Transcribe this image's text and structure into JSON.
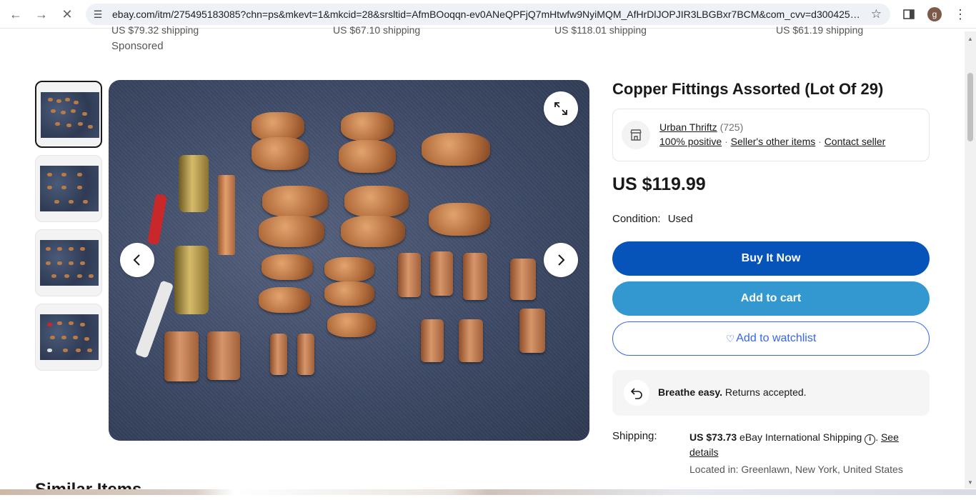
{
  "browser": {
    "url": "ebay.com/itm/275495183085?chn=ps&mkevt=1&mkcid=28&srsltid=AfmBOoqqn-ev0ANeQPFjQ7mHtwfw9NyiMQM_AfHrDlJOPJIR3LBGBxr7BCM&com_cvv=d30042528...",
    "avatar_letter": "g"
  },
  "sponsored_strip": {
    "items": [
      "US $79.32 shipping",
      "US $67.10 shipping",
      "US $118.01 shipping",
      "US $61.19 shipping"
    ],
    "sponsored_label": "Sponsored"
  },
  "listing": {
    "title": "Copper Fittings Assorted (Lot Of 29)",
    "seller": {
      "name": "Urban Thriftz",
      "feedback_count": "(725)",
      "positive": "100% positive",
      "other_items": "Seller's other items",
      "contact": "Contact seller"
    },
    "price": "US $119.99",
    "condition_label": "Condition:",
    "condition_value": "Used",
    "buttons": {
      "buy": "Buy It Now",
      "cart": "Add to cart",
      "watch": "Add to watchlist"
    },
    "returns": {
      "bold": "Breathe easy.",
      "text": " Returns accepted."
    },
    "shipping": {
      "label": "Shipping:",
      "amount": "US $73.73",
      "method": " eBay International Shipping ",
      "see_details": "See details",
      "location": "Located in: Greenlawn, New York, United States"
    }
  },
  "similar_heading": "Similar Items",
  "colors": {
    "buy_now": "#0654ba",
    "add_to_cart": "#3397d0",
    "watchlist_border": "#3665f3"
  }
}
